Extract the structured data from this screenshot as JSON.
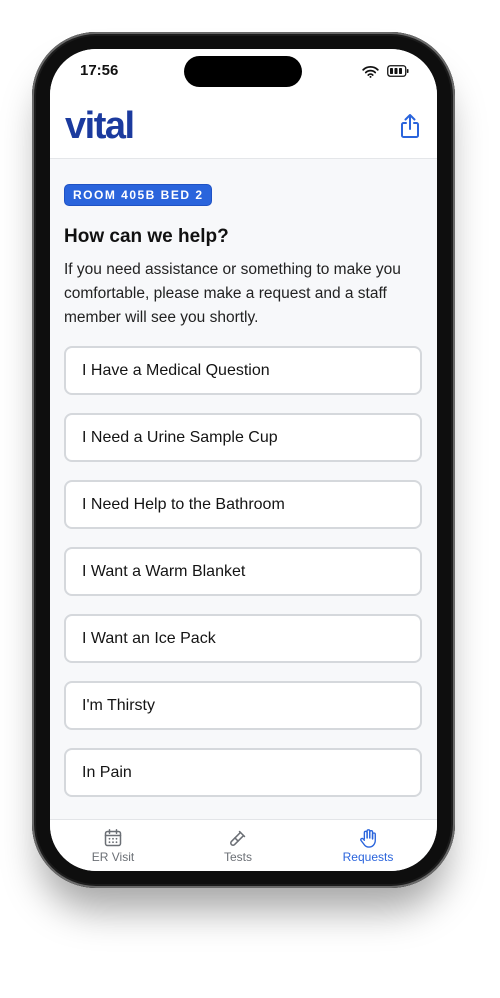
{
  "status_bar": {
    "time": "17:56",
    "wifi_icon": "wifi-icon",
    "battery_icon": "battery-icon"
  },
  "header": {
    "logo_text": "vital",
    "share_icon": "share-icon"
  },
  "location_badge": {
    "label": "ROOM 405B BED 2"
  },
  "intro": {
    "heading": "How can we help?",
    "body": "If you need assistance or something to make you comfortable, please make a request and a staff member will see you shortly."
  },
  "requests": [
    {
      "label": "I Have a Medical Question"
    },
    {
      "label": "I Need a Urine Sample Cup"
    },
    {
      "label": "I Need Help to the Bathroom"
    },
    {
      "label": "I Want a Warm Blanket"
    },
    {
      "label": "I Want an Ice Pack"
    },
    {
      "label": "I'm Thirsty"
    },
    {
      "label": "In Pain"
    }
  ],
  "tab_bar": {
    "tabs": [
      {
        "label": "ER Visit",
        "icon": "calendar-icon",
        "active": false
      },
      {
        "label": "Tests",
        "icon": "test-tube-icon",
        "active": false
      },
      {
        "label": "Requests",
        "icon": "hand-icon",
        "active": true
      }
    ]
  },
  "colors": {
    "brand": "#1b3a9e",
    "accent": "#2a64dc",
    "screen_background": "#f7f8fa",
    "card_border": "#d5d8dc",
    "inactive_tab": "#6b6f75"
  }
}
